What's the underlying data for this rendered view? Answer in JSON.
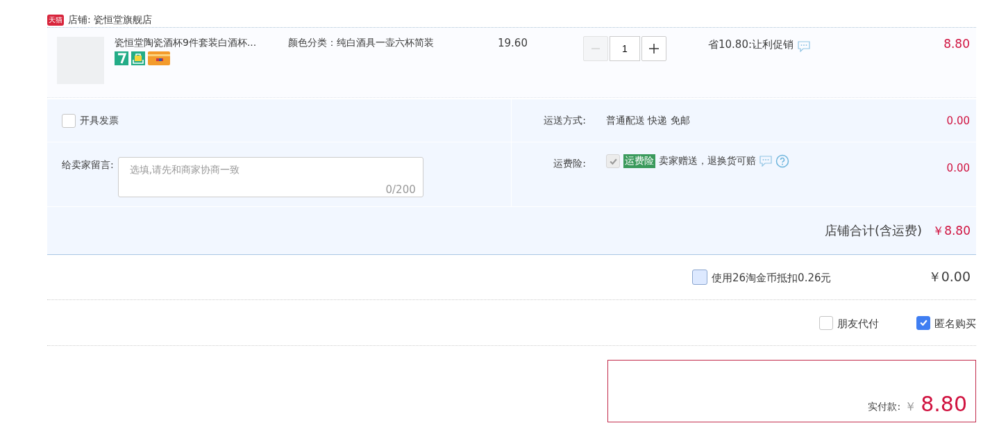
{
  "shop": {
    "badge": "天猫",
    "label": "店铺: 瓷恒堂旗舰店"
  },
  "item": {
    "title": "瓷恒堂陶瓷酒杯9件套装白酒杯...",
    "sku": "颜色分类：纯白酒具一壶六杯简装",
    "price": "19.60",
    "quantity": "1",
    "minus_disabled": true,
    "promo": "省10.80:让利促销",
    "total": "8.80"
  },
  "invoice": {
    "label": "开具发票",
    "checked": false
  },
  "memo": {
    "label": "给卖家留言:",
    "placeholder": "选填,请先和商家协商一致",
    "counter": "0/200"
  },
  "shipping": {
    "label": "运送方式:",
    "value": "普通配送 快递 免邮",
    "fee": "0.00"
  },
  "insurance": {
    "label": "运费险:",
    "checked": true,
    "disabled": true,
    "tag": "运费险",
    "text": "卖家赠送，退换货可赔",
    "fee": "0.00"
  },
  "shop_total": {
    "label": "店铺合计(含运费)",
    "amount": "￥8.80"
  },
  "coins": {
    "label": "使用26淘金币抵扣0.26元",
    "checked": false,
    "amount": "￥0.00"
  },
  "options": [
    {
      "label": "朋友代付",
      "checked": false
    },
    {
      "label": "匿名购买",
      "checked": true
    }
  ],
  "payment": {
    "label": "实付款:",
    "currency": "￥",
    "amount": "8.80"
  }
}
